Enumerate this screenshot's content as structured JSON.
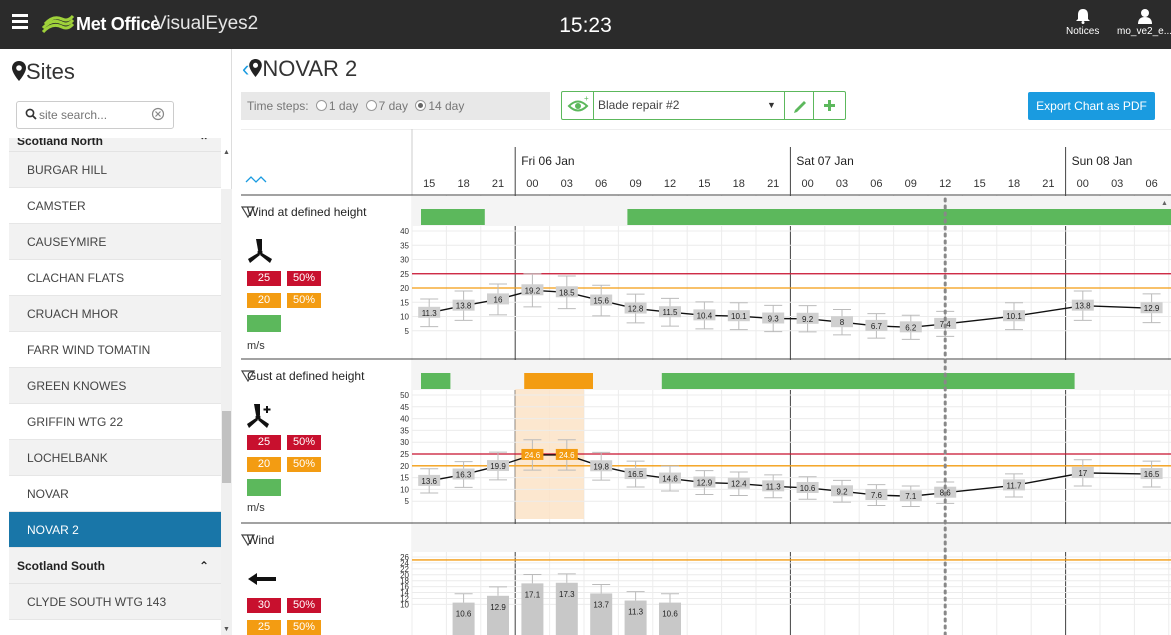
{
  "header": {
    "brand": "Met Office",
    "app_name": "VisualEyes2",
    "time": "15:23",
    "notices_label": "Notices",
    "user_label": "mo_ve2_e..."
  },
  "sidebar": {
    "title": "Sites",
    "search_placeholder": "site search...",
    "group1": "Scotland North",
    "items": [
      "BURGAR HILL",
      "CAMSTER",
      "CAUSEYMIRE",
      "CLACHAN FLATS",
      "CRUACH MHOR",
      "FARR WIND TOMATIN",
      "GREEN KNOWES",
      "GRIFFIN WTG 22",
      "LOCHELBANK",
      "NOVAR",
      "NOVAR 2"
    ],
    "active_item": "NOVAR 2",
    "group2": "Scotland South",
    "items2": [
      "CLYDE SOUTH WTG 143"
    ]
  },
  "main": {
    "site_title": "NOVAR 2",
    "timesteps_label": "Time steps:",
    "timestep_options": [
      "1 day",
      "7 day",
      "14 day"
    ],
    "timestep_selected": "14 day",
    "activity_select": "Blade repair #2",
    "export_label": "Export Chart as PDF"
  },
  "colors": {
    "accent": "#1a9be0",
    "active": "#1976a8",
    "red": "#c8102e",
    "orange": "#f39c12",
    "green": "#5cb85c"
  },
  "chart_data": {
    "type": "line",
    "days": [
      {
        "label": "Fri 06 Jan",
        "hour_index": 3
      },
      {
        "label": "Sat 07 Jan",
        "hour_index": 11
      },
      {
        "label": "Sun 08 Jan",
        "hour_index": 19
      }
    ],
    "hours": [
      "15",
      "18",
      "21",
      "00",
      "03",
      "06",
      "09",
      "12",
      "15",
      "18",
      "21",
      "00",
      "03",
      "06",
      "09",
      "12",
      "15",
      "18",
      "21",
      "00",
      "03",
      "06"
    ],
    "current_hour_index": 15,
    "panels": [
      {
        "name": "Wind at defined height",
        "icon": "turbine-icon",
        "thresholds": [
          {
            "value": "25",
            "pct": "50%",
            "color": "red"
          },
          {
            "value": "20",
            "pct": "50%",
            "color": "orange"
          }
        ],
        "unit": "m/s",
        "ylim": [
          0,
          40
        ],
        "yticks": [
          "40",
          "35",
          "30",
          "25",
          "20",
          "15",
          "10",
          "5"
        ],
        "status": [
          {
            "from": 0,
            "to": 2,
            "color": "green"
          },
          {
            "from": 6,
            "to": 22,
            "color": "green"
          }
        ],
        "values": [
          11.3,
          13.8,
          16,
          19.2,
          18.5,
          15.6,
          12.8,
          11.5,
          10.4,
          10.1,
          9.3,
          9.2,
          8,
          6.7,
          6.2,
          7.4,
          null,
          10.1,
          null,
          13.8,
          null,
          12.9
        ]
      },
      {
        "name": "Gust at defined height",
        "icon": "turbine-gust-icon",
        "thresholds": [
          {
            "value": "25",
            "pct": "50%",
            "color": "red"
          },
          {
            "value": "20",
            "pct": "50%",
            "color": "orange"
          }
        ],
        "unit": "m/s",
        "ylim": [
          0,
          50
        ],
        "yticks": [
          "50",
          "45",
          "40",
          "35",
          "30",
          "25",
          "20",
          "15",
          "10",
          "5"
        ],
        "status": [
          {
            "from": 0,
            "to": 1,
            "color": "green"
          },
          {
            "from": 3,
            "to": 5,
            "color": "orange"
          },
          {
            "from": 7,
            "to": 19,
            "color": "green"
          }
        ],
        "values": [
          13.6,
          16.3,
          19.9,
          24.6,
          24.6,
          19.8,
          16.5,
          14.6,
          12.9,
          12.4,
          11.3,
          10.6,
          9.2,
          7.6,
          7.1,
          8.6,
          null,
          11.7,
          null,
          17,
          null,
          16.5
        ]
      },
      {
        "name": "Wind",
        "icon": "arrow-left-icon",
        "thresholds": [
          {
            "value": "30",
            "pct": "50%",
            "color": "red"
          },
          {
            "value": "25",
            "pct": "50%",
            "color": "orange"
          }
        ],
        "unit": "",
        "ylim": [
          0,
          26
        ],
        "yticks": [
          "26",
          "24",
          "22",
          "20",
          "18",
          "16",
          "14",
          "12",
          "10"
        ],
        "status": [],
        "values": [
          null,
          10.6,
          12.9,
          17.1,
          17.3,
          13.7,
          11.3,
          10.6
        ]
      }
    ]
  }
}
